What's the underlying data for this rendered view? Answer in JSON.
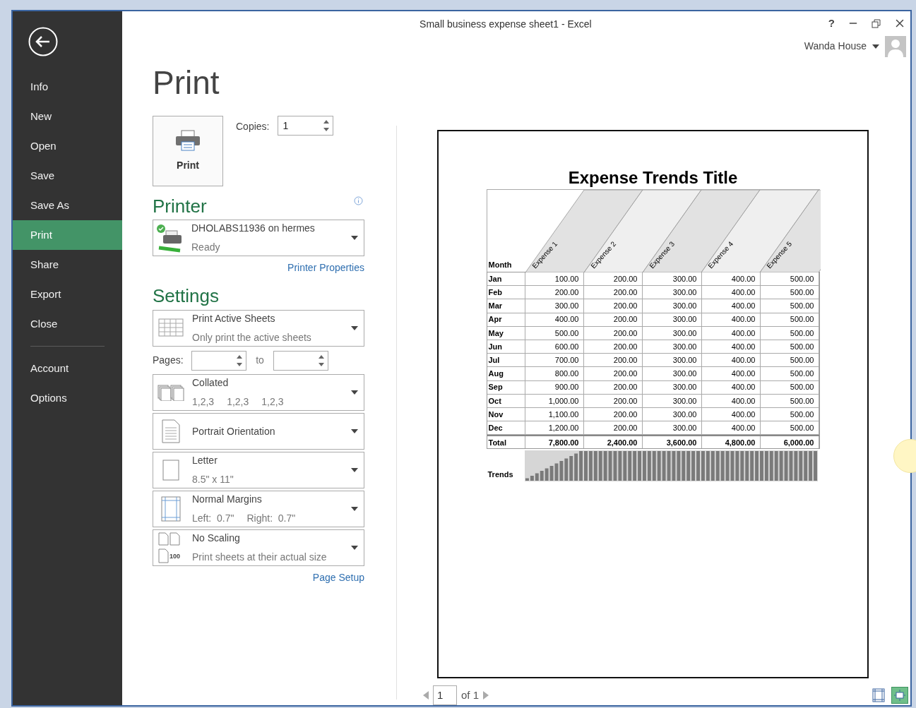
{
  "window": {
    "title": "Small business expense sheet1 - Excel",
    "help": "?"
  },
  "account": {
    "name": "Wanda House"
  },
  "sidebar": {
    "items": [
      {
        "label": "Info",
        "selected": false
      },
      {
        "label": "New",
        "selected": false
      },
      {
        "label": "Open",
        "selected": false
      },
      {
        "label": "Save",
        "selected": false
      },
      {
        "label": "Save As",
        "selected": false
      },
      {
        "label": "Print",
        "selected": true
      },
      {
        "label": "Share",
        "selected": false
      },
      {
        "label": "Export",
        "selected": false
      },
      {
        "label": "Close",
        "selected": false
      }
    ],
    "secondary_items": [
      {
        "label": "Account",
        "selected": false
      },
      {
        "label": "Options",
        "selected": false
      }
    ]
  },
  "page_title": "Print",
  "print_button": {
    "label": "Print"
  },
  "copies": {
    "label": "Copies:",
    "value": "1"
  },
  "printer": {
    "heading": "Printer",
    "name": "DHOLABS11936 on hermes",
    "status": "Ready",
    "link": "Printer Properties"
  },
  "settings": {
    "heading": "Settings",
    "options": [
      {
        "kind": "sheets",
        "title": "Print Active Sheets",
        "details": [
          "Only print the active sheets"
        ]
      },
      {
        "kind": "pages",
        "label": "Pages:",
        "to_label": "to"
      },
      {
        "kind": "collate",
        "title": "Collated",
        "details": [
          "1,2,3",
          "1,2,3",
          "1,2,3"
        ]
      },
      {
        "kind": "portrait",
        "title": "Portrait Orientation"
      },
      {
        "kind": "letter",
        "title": "Letter",
        "details": [
          "8.5\" x 11\""
        ]
      },
      {
        "kind": "margins",
        "title": "Normal Margins",
        "details": [
          "Left:  0.7\"",
          "Right:  0.7\""
        ]
      },
      {
        "kind": "scaling",
        "title": "No Scaling",
        "details": [
          "Print sheets at their actual size"
        ],
        "icon_text": "100"
      }
    ],
    "link": "Page Setup"
  },
  "preview": {
    "title": "Expense Trends Title",
    "columns": [
      "Month",
      "Expense 1",
      "Expense 2",
      "Expense 3",
      "Expense 4",
      "Expense 5"
    ],
    "rows": [
      [
        "Jan",
        "100.00",
        "200.00",
        "300.00",
        "400.00",
        "500.00"
      ],
      [
        "Feb",
        "200.00",
        "200.00",
        "300.00",
        "400.00",
        "500.00"
      ],
      [
        "Mar",
        "300.00",
        "200.00",
        "300.00",
        "400.00",
        "500.00"
      ],
      [
        "Apr",
        "400.00",
        "200.00",
        "300.00",
        "400.00",
        "500.00"
      ],
      [
        "May",
        "500.00",
        "200.00",
        "300.00",
        "400.00",
        "500.00"
      ],
      [
        "Jun",
        "600.00",
        "200.00",
        "300.00",
        "400.00",
        "500.00"
      ],
      [
        "Jul",
        "700.00",
        "200.00",
        "300.00",
        "400.00",
        "500.00"
      ],
      [
        "Aug",
        "800.00",
        "200.00",
        "300.00",
        "400.00",
        "500.00"
      ],
      [
        "Sep",
        "900.00",
        "200.00",
        "300.00",
        "400.00",
        "500.00"
      ],
      [
        "Oct",
        "1,000.00",
        "200.00",
        "300.00",
        "400.00",
        "500.00"
      ],
      [
        "Nov",
        "1,100.00",
        "200.00",
        "300.00",
        "400.00",
        "500.00"
      ],
      [
        "Dec",
        "1,200.00",
        "200.00",
        "300.00",
        "400.00",
        "500.00"
      ]
    ],
    "total": [
      "Total",
      "7,800.00",
      "2,400.00",
      "3,600.00",
      "4,800.00",
      "6,000.00"
    ],
    "trends_label": "Trends"
  },
  "pager": {
    "page": "1",
    "of": "of 1"
  },
  "view_buttons": [
    {
      "kind": "margins",
      "selected": false
    },
    {
      "kind": "zoom",
      "selected": true
    }
  ]
}
